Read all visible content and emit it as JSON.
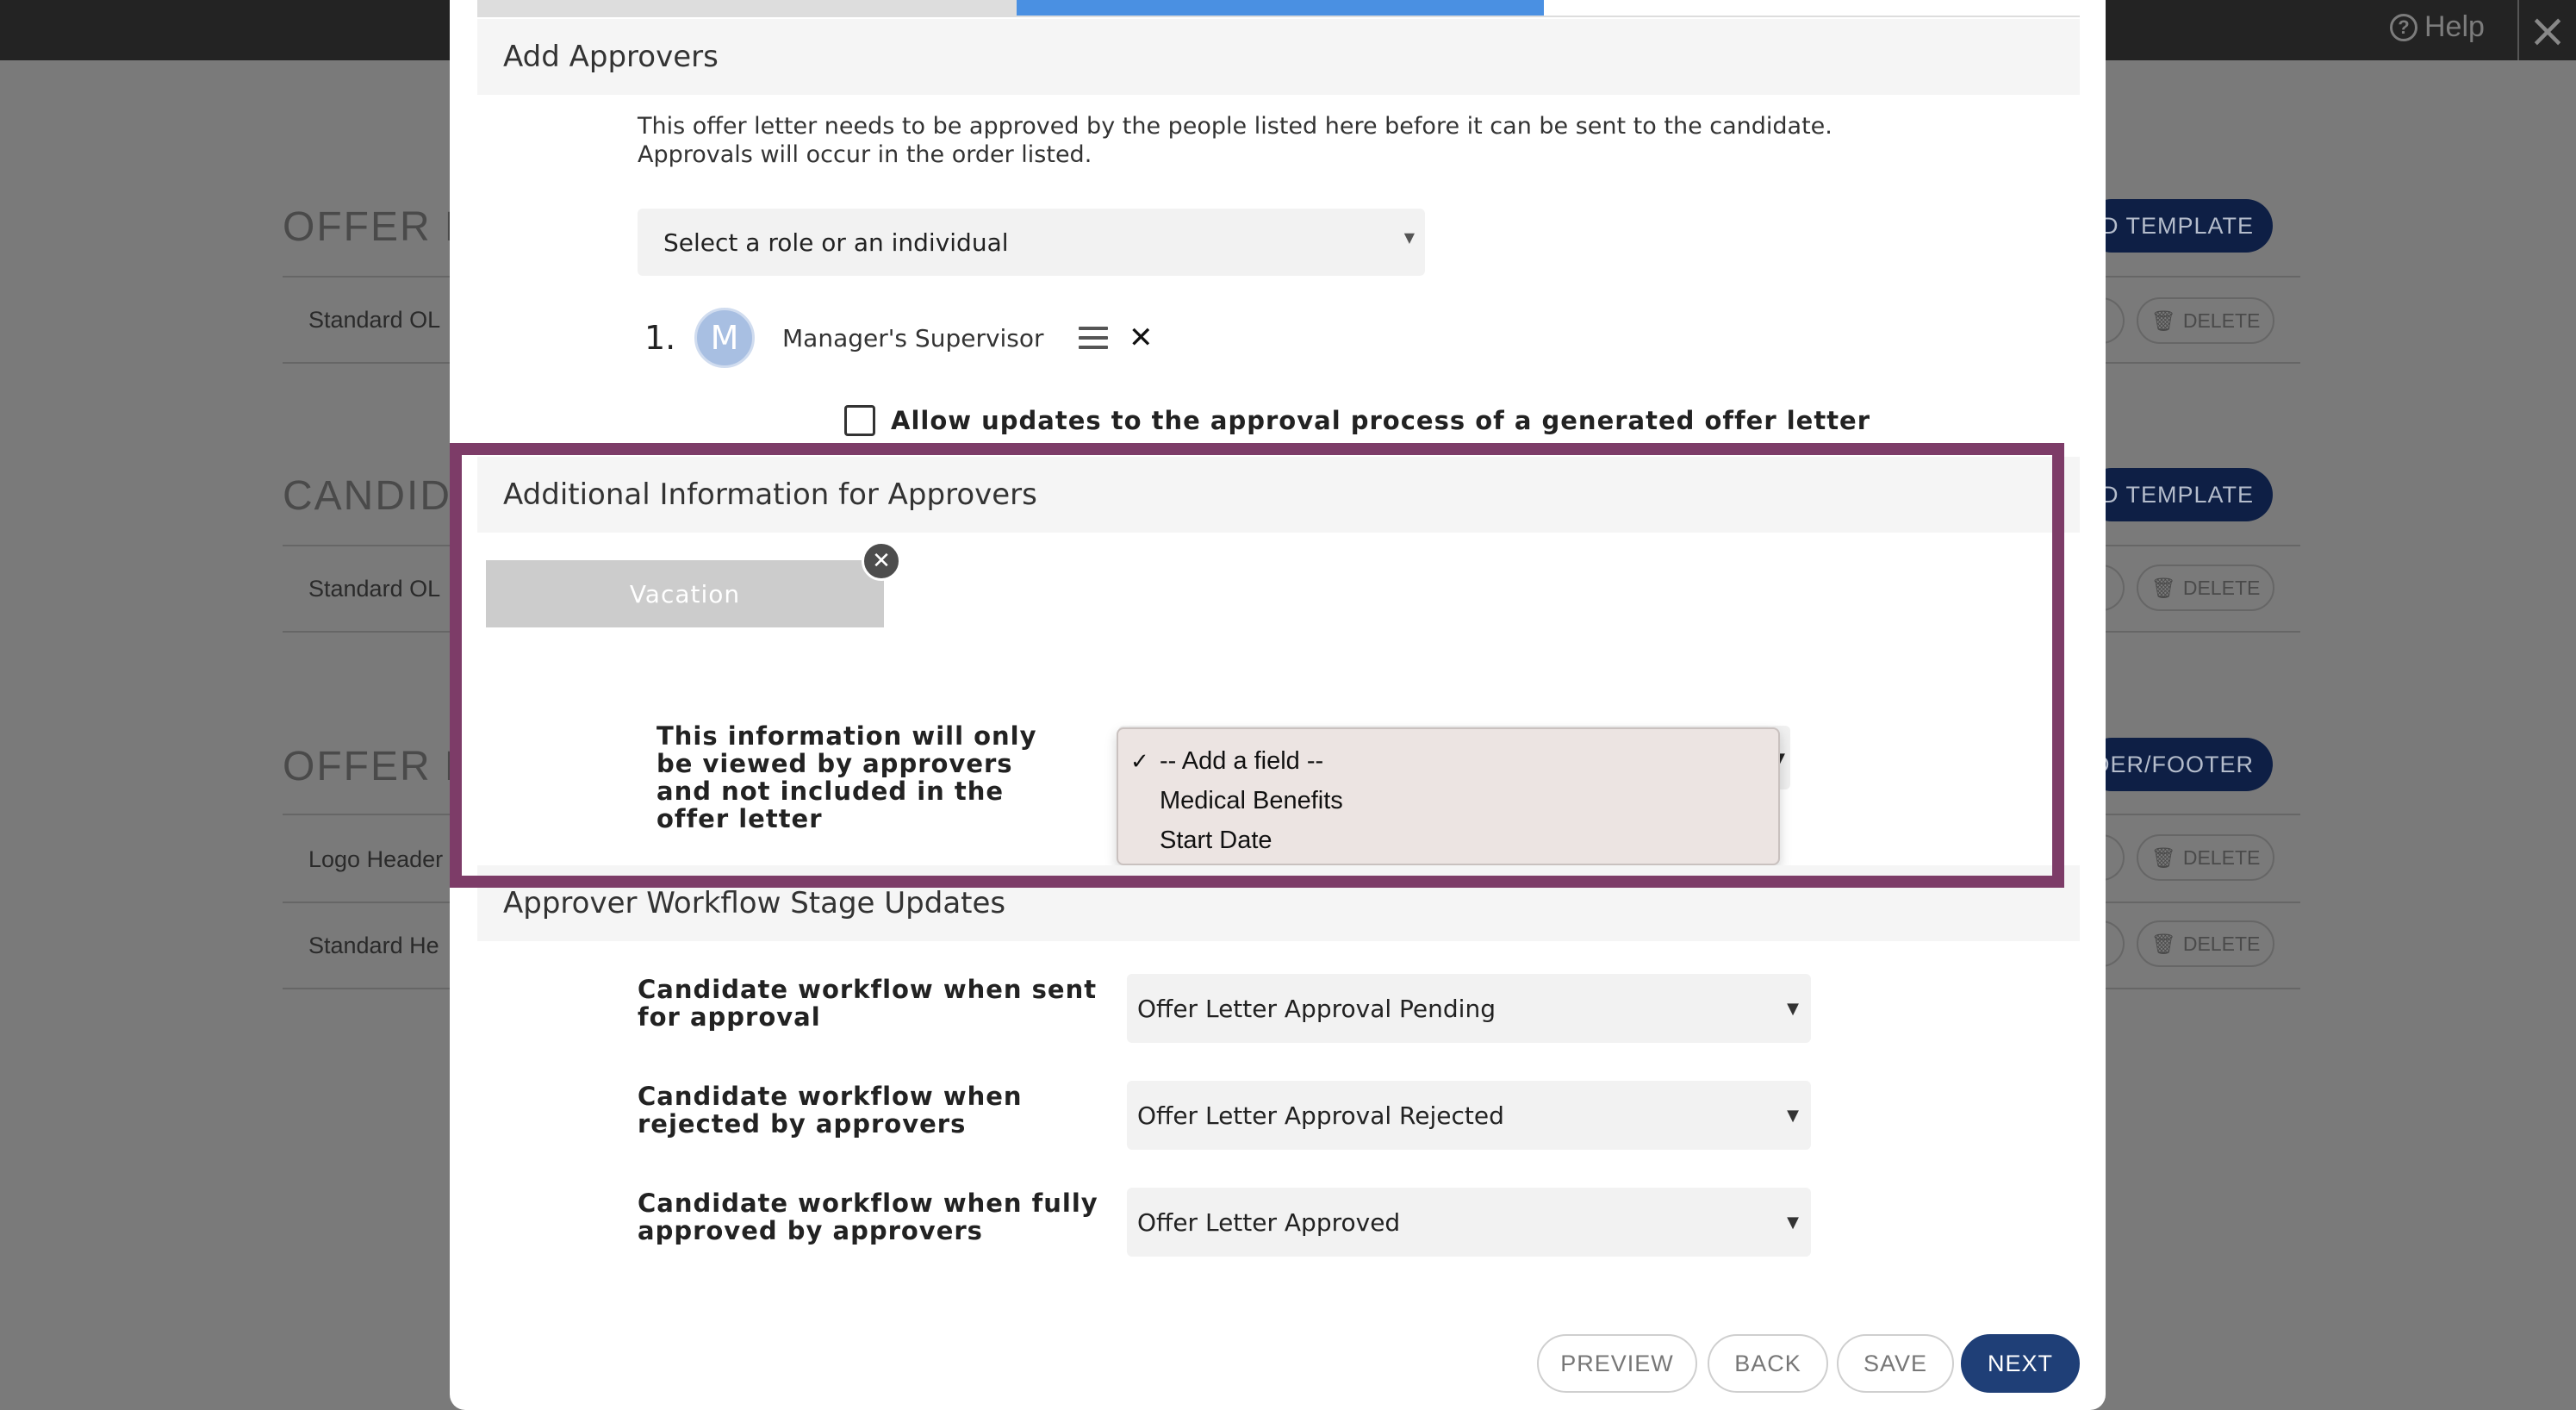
{
  "topbar": {
    "help_label": "Help",
    "help_icon": "?",
    "close_icon": "×"
  },
  "background": {
    "sections": [
      {
        "title": "OFFER LE",
        "button_label": "D TEMPLATE",
        "rows": [
          "Standard OL"
        ]
      },
      {
        "title": "CANDIDA",
        "button_label": "D TEMPLATE",
        "rows": [
          "Standard OL"
        ]
      },
      {
        "title": "OFFER LE",
        "button_label": "DER/FOOTER",
        "rows": [
          "Logo Header",
          "Standard He"
        ]
      }
    ],
    "delete_label": "DELETE"
  },
  "modal": {
    "add_approvers": {
      "title": "Add Approvers",
      "intro": "This offer letter needs to be approved by the people listed here before it can be sent to the candidate. Approvals will occur in the order listed.",
      "role_select_value": "Select a role or an individual",
      "approvers": [
        {
          "number": "1.",
          "initial": "M",
          "name": "Manager's Supervisor"
        }
      ],
      "remove_icon": "✕",
      "allow_updates_label": "Allow updates to the approval process of a generated offer letter"
    },
    "additional_info": {
      "title": "Additional Information for Approvers",
      "chip_label": "Vacation",
      "chip_remove_icon": "✕",
      "note": "This information will only be viewed by approvers and not included in the offer letter",
      "dropdown": {
        "options": [
          "-- Add a field --",
          "Medical Benefits",
          "Start Date"
        ],
        "selected_index": 0,
        "check_icon": "✓"
      }
    },
    "workflow": {
      "title": "Approver Workflow Stage Updates",
      "rows": [
        {
          "label": "Candidate workflow when sent for approval",
          "value": "Offer Letter Approval Pending"
        },
        {
          "label": "Candidate workflow when rejected by approvers",
          "value": "Offer Letter Approval Rejected"
        },
        {
          "label": "Candidate workflow when fully approved by approvers",
          "value": "Offer Letter Approved"
        }
      ]
    },
    "footer": {
      "preview": "PREVIEW",
      "back": "BACK",
      "save": "SAVE",
      "next": "NEXT"
    }
  },
  "colors": {
    "accent": "#4a90e2",
    "primary_button": "#1f3f77",
    "highlight": "#7d3c68"
  }
}
